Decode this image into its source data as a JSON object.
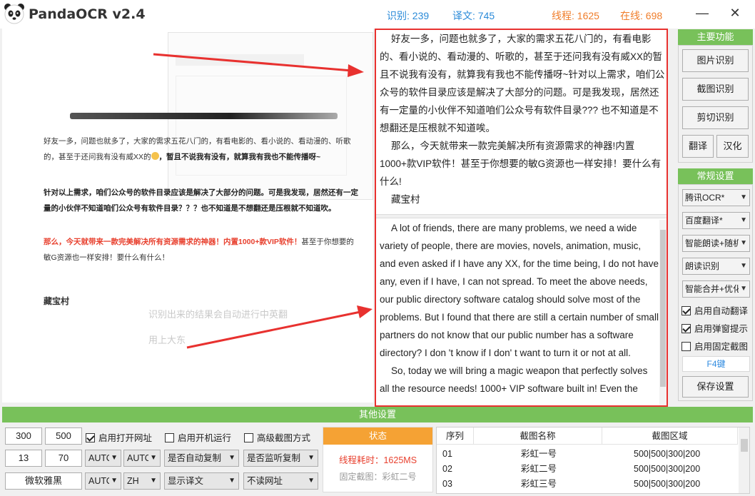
{
  "app": {
    "title": "PandaOCR v2.4"
  },
  "stats": {
    "recognize": "识别: 239",
    "translate": "译文: 745",
    "threads": "线程: 1625",
    "online": "在线: 698"
  },
  "window": {
    "minimize": "—",
    "close": "✕"
  },
  "preview": {
    "para1": "好友一多，问题也就多了，大家的需求五花八门的，有看电影的、看小说的、看动漫的、听歌的，甚至于还问我有没有威XX的",
    "para1b": "，暂且不说我有没有，就算我有我也不能传播呀~",
    "para2": "针对以上需求，咱们公众号的软件目录应该是解决了大部分的问题。可是我发现，居然还有一定量的小伙伴不知道咱们公众号有软件目录？？？也不知道是不想翻还是压根就不知道吹。",
    "para3_red": "那么，今天就带来一款完美解决所有资源需求的神器！内置1000+款VIP软件！",
    "para3_rest": "甚至于你想要的敏G资源也一样安排！要什么有什么！",
    "treasure": "藏宝村",
    "faint1": "识别出来的结果会自动进行中英翻",
    "faint2": "用上大东"
  },
  "ocr": {
    "cn_p1": "好友一多，问题也就多了，大家的需求五花八门的，有看电影的、看小说的、看动漫的、听歌的，甚至于还问我有没有威XX的暂且不说我有没有，就算我有我也不能传播呀~针对以上需求，咱们公众号的软件目录应该是解决了大部分的问题。可是我发现，居然还有一定量的小伙伴不知道咱们公众号有软件目录??? 也不知道是不想翻还是压根就不知道唉。",
    "cn_p2": "那么，今天就带来一款完美解决所有资源需求的神器!内置1000+款VIP软件！甚至于你想要的敏G资源也一样安排！要什么有什么!",
    "cn_p3": "藏宝村",
    "en_p1": "A lot of friends, there are many problems, we need a wide variety of people, there are movies, novels, animation, music, and even asked if I have any XX, for the time being, I do not have any, even if I have, I can not spread. To meet the above needs, our public directory software catalog should solve most of the problems. But I found that there are still a certain number of small partners do not know that our public number has a software directory? I don 't know if I don' t want to turn it or not at all.",
    "en_p2": "So, today we will bring a magic weapon that perfectly solves all the resource needs! 1000+ VIP software built in! Even the"
  },
  "sidebar": {
    "main_head": "主要功能",
    "btn_image": "图片识别",
    "btn_screenshot": "截图识别",
    "btn_clipboard": "剪切识别",
    "btn_translate": "翻译",
    "btn_hanhua": "汉化",
    "settings_head": "常规设置",
    "select_ocr": "腾讯OCR*",
    "select_trans": "百度翻译*",
    "select_read": "智能朗读+随机",
    "select_readrec": "朗读识别",
    "select_merge": "智能合并+优化",
    "chk_autotrans": "启用自动翻译",
    "chk_popup": "启用弹窗提示",
    "chk_fixed": "启用固定截图",
    "hotkey": "F4键",
    "btn_save": "保存设置"
  },
  "bottom": {
    "head": "其他设置",
    "w": "300",
    "h": "500",
    "x": "13",
    "y": "70",
    "font": "微软雅黑",
    "auto1": "AUTO",
    "auto2": "AUTO",
    "auto3": "AUTO",
    "zh": "ZH",
    "chk_openurl": "启用打开网址",
    "chk_boot": "启用开机运行",
    "chk_advshot": "高级截图方式",
    "dd_autocopy": "是否自动复制",
    "dd_monitor": "是否监听复制",
    "dd_showtrans": "显示译文",
    "dd_noread": "不读网址",
    "status_head": "状态",
    "status_time": "线程耗时：1625MS",
    "status_fixed": "固定截图：彩虹二号",
    "table": {
      "headers": [
        "序列",
        "截图名称",
        "截图区域"
      ],
      "rows": [
        [
          "01",
          "彩虹一号",
          "500|500|300|200"
        ],
        [
          "02",
          "彩虹二号",
          "500|500|300|200"
        ],
        [
          "03",
          "彩虹三号",
          "500|500|300|200"
        ]
      ]
    }
  },
  "colors": {
    "accent_green": "#78c15a",
    "stat_blue": "#2a8ad8",
    "stat_orange": "#f07d2a",
    "highlight_red": "#e8312f",
    "status_orange": "#f5a234"
  }
}
